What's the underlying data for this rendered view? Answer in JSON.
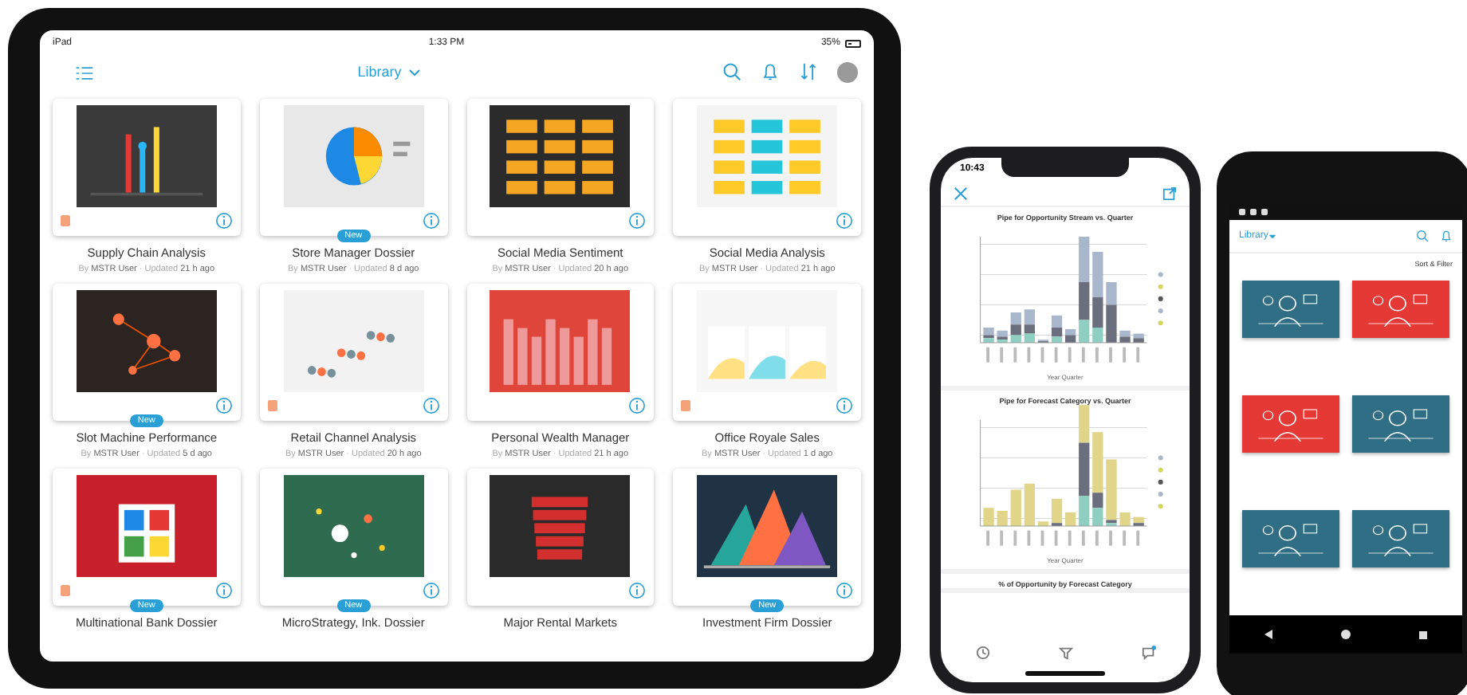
{
  "tablet": {
    "status_bar": {
      "carrier": "iPad",
      "time": "1:33 PM",
      "battery": "35%"
    },
    "header": {
      "title": "Library"
    },
    "cards": [
      {
        "title": "Supply Chain Analysis",
        "flagged": true,
        "byline": "By **MSTR User** · Updated **21 h ago**"
      },
      {
        "title": "Store Manager Dossier",
        "badge": "New",
        "flagged": false,
        "byline": "By **MSTR User** · Updated **8 d ago**"
      },
      {
        "title": "Social Media Sentiment",
        "flagged": false,
        "byline": "By **MSTR User** · Updated **20 h ago**"
      },
      {
        "title": "Social Media Analysis",
        "flagged": false,
        "byline": "By **MSTR User** · Updated **21 h ago**"
      },
      {
        "title": "Slot Machine Performance",
        "badge": "New",
        "flagged": false,
        "byline": "By **MSTR User** · Updated **5 d ago**"
      },
      {
        "title": "Retail Channel Analysis",
        "flagged": true,
        "byline": "By **MSTR User** · Updated **20 h ago**"
      },
      {
        "title": "Personal Wealth Manager",
        "flagged": false,
        "byline": "By **MSTR User** · Updated **21 h ago**"
      },
      {
        "title": "Office Royale Sales",
        "flagged": true,
        "byline": "By **MSTR User** · Updated **1 d ago**"
      },
      {
        "title": "Multinational Bank Dossier",
        "badge": "New",
        "flagged": true
      },
      {
        "title": "MicroStrategy, Ink. Dossier",
        "badge": "New",
        "flagged": false
      },
      {
        "title": "Major Rental Markets",
        "flagged": false
      },
      {
        "title": "Investment Firm Dossier",
        "badge": "New",
        "flagged": false
      }
    ]
  },
  "phone": {
    "status_bar": {
      "time": "10:43"
    },
    "charts": [
      {
        "title": "Pipe for Opportunity Stream vs. Quarter",
        "xlabel": "Year Quarter",
        "kind": "stacked"
      },
      {
        "title": "Pipe for Forecast Category vs. Quarter",
        "xlabel": "Year Quarter",
        "kind": "forecast"
      },
      {
        "title": "% of Opportunity by Forecast Category"
      }
    ]
  },
  "android": {
    "header": {
      "title": "Library"
    },
    "sort_label": "Sort & Filter"
  }
}
